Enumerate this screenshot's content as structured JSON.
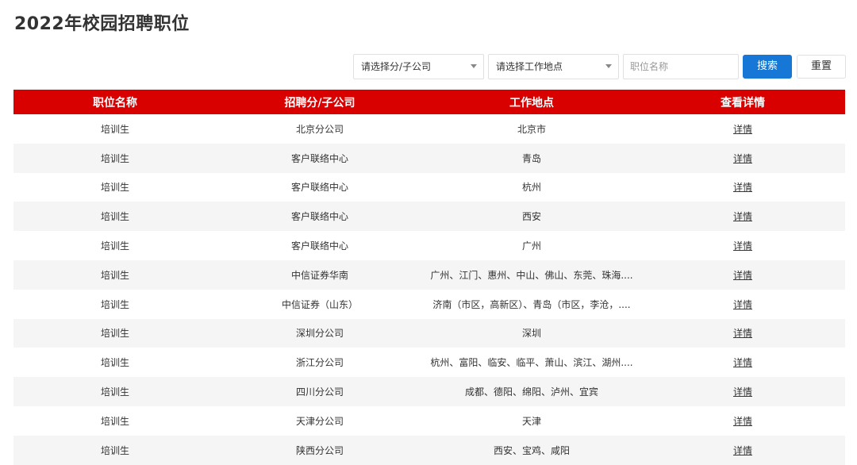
{
  "page": {
    "title": "2022年校园招聘职位"
  },
  "filters": {
    "branch_placeholder": "请选择分/子公司",
    "location_placeholder": "请选择工作地点",
    "position_placeholder": "职位名称",
    "search_label": "搜索",
    "reset_label": "重置"
  },
  "colors": {
    "header_bg": "#d90000",
    "search_button": "#1677d6",
    "stripe": "#f5f5f5"
  },
  "icons": {
    "select_caret": "chevron-down-icon"
  },
  "table": {
    "headers": [
      "职位名称",
      "招聘分/子公司",
      "工作地点",
      "查看详情"
    ],
    "rows": [
      {
        "position": "培训生",
        "branch": "北京分公司",
        "location": "北京市",
        "detail": "详情"
      },
      {
        "position": "培训生",
        "branch": "客户联络中心",
        "location": "青岛",
        "detail": "详情"
      },
      {
        "position": "培训生",
        "branch": "客户联络中心",
        "location": "杭州",
        "detail": "详情"
      },
      {
        "position": "培训生",
        "branch": "客户联络中心",
        "location": "西安",
        "detail": "详情"
      },
      {
        "position": "培训生",
        "branch": "客户联络中心",
        "location": "广州",
        "detail": "详情"
      },
      {
        "position": "培训生",
        "branch": "中信证券华南",
        "location": "广州、江门、惠州、中山、佛山、东莞、珠海....",
        "detail": "详情"
      },
      {
        "position": "培训生",
        "branch": "中信证券（山东）",
        "location": "济南（市区，高新区）、青岛（市区，李沧，....",
        "detail": "详情"
      },
      {
        "position": "培训生",
        "branch": "深圳分公司",
        "location": "深圳",
        "detail": "详情"
      },
      {
        "position": "培训生",
        "branch": "浙江分公司",
        "location": "杭州、富阳、临安、临平、萧山、滨江、湖州....",
        "detail": "详情"
      },
      {
        "position": "培训生",
        "branch": "四川分公司",
        "location": "成都、德阳、绵阳、泸州、宜宾",
        "detail": "详情"
      },
      {
        "position": "培训生",
        "branch": "天津分公司",
        "location": "天津",
        "detail": "详情"
      },
      {
        "position": "培训生",
        "branch": "陕西分公司",
        "location": "西安、宝鸡、咸阳",
        "detail": "详情"
      }
    ]
  }
}
